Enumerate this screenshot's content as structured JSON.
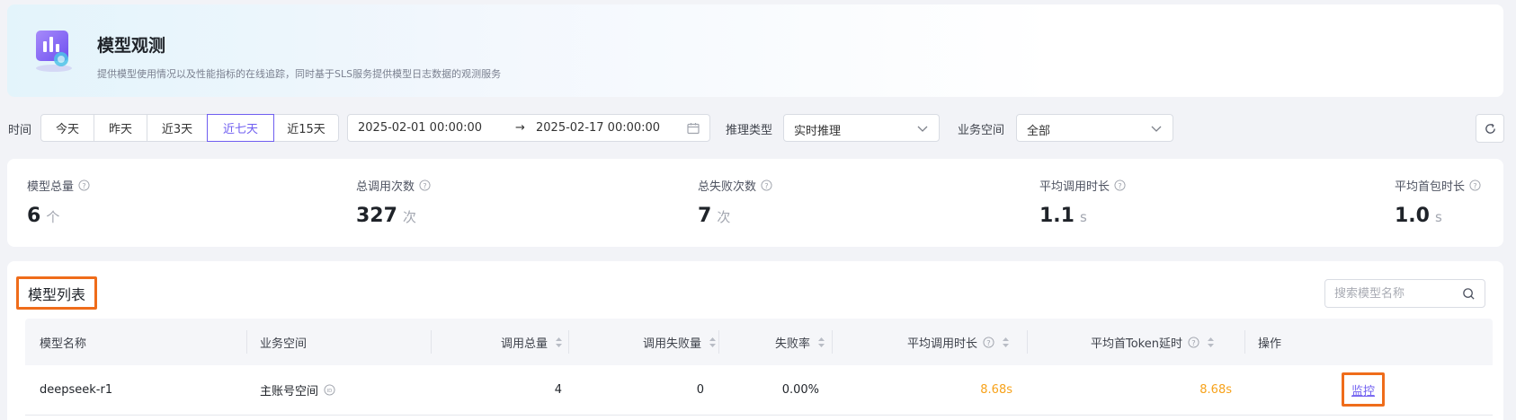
{
  "header": {
    "title": "模型观测",
    "description": "提供模型使用情况以及性能指标的在线追踪，同时基于SLS服务提供模型日志数据的观测服务",
    "logo_icon": "chart-logo-icon"
  },
  "filters": {
    "time_label": "时间",
    "time_options": [
      "今天",
      "昨天",
      "近3天",
      "近七天",
      "近15天"
    ],
    "active_time": "近七天",
    "date_start": "2025-02-01 00:00:00",
    "date_end": "2025-02-17 00:00:00",
    "inference_label": "推理类型",
    "inference_value": "实时推理",
    "workspace_label": "业务空间",
    "workspace_value": "全部"
  },
  "stats": [
    {
      "label": "模型总量",
      "value": "6",
      "unit": "个"
    },
    {
      "label": "总调用次数",
      "value": "327",
      "unit": "次"
    },
    {
      "label": "总失败次数",
      "value": "7",
      "unit": "次"
    },
    {
      "label": "平均调用时长",
      "value": "1.1",
      "unit": "s"
    },
    {
      "label": "平均首包时长",
      "value": "1.0",
      "unit": "s"
    }
  ],
  "model_list": {
    "title": "模型列表",
    "search_placeholder": "搜索模型名称",
    "columns": [
      "模型名称",
      "业务空间",
      "调用总量",
      "调用失败量",
      "失败率",
      "平均调用时长",
      "平均首Token延时",
      "操作"
    ],
    "rows": [
      {
        "name": "deepseek-r1",
        "workspace": "主账号空间",
        "total_calls": "4",
        "failed_calls": "0",
        "failure_rate": "0.00%",
        "avg_duration": "8.68s",
        "avg_first_token": "8.68s",
        "action": "监控"
      }
    ]
  },
  "colors": {
    "accent": "#6f5ef0",
    "highlight_orange": "#ef6c1a",
    "latency_value": "#f7a21a"
  }
}
